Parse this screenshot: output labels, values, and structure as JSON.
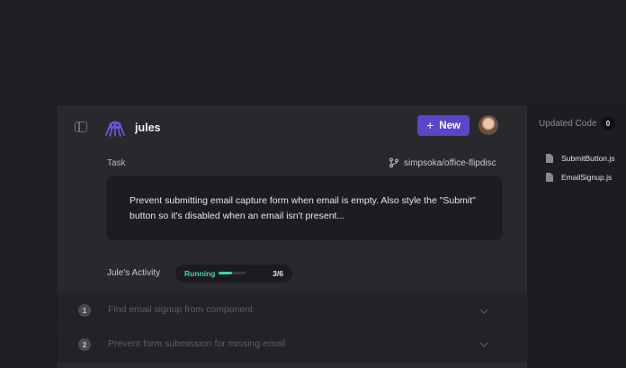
{
  "header": {
    "app_name": "jules",
    "new_button_label": "New",
    "new_button_icon": "plus-icon"
  },
  "task": {
    "label": "Task",
    "repo": "simpsoka/office-flipdisc",
    "description": "Prevent submitting email capture form when email is empty. Also style the \"Submit\" button so it's disabled when an email isn't present..."
  },
  "activity": {
    "label": "Jule's Activity",
    "status": "Running",
    "progress_fraction": 0.5,
    "progress_text": "3/6"
  },
  "steps": [
    {
      "number": "1",
      "text": "Find email signup from component"
    },
    {
      "number": "2",
      "text": "Prevent form submission for missing email"
    }
  ],
  "updated_code": {
    "title": "Updated Code",
    "count": "0",
    "files": [
      "SubmitButton.js",
      "EmailSignup.js"
    ]
  },
  "colors": {
    "accent": "#5b45c9",
    "running": "#3fd3b4"
  }
}
